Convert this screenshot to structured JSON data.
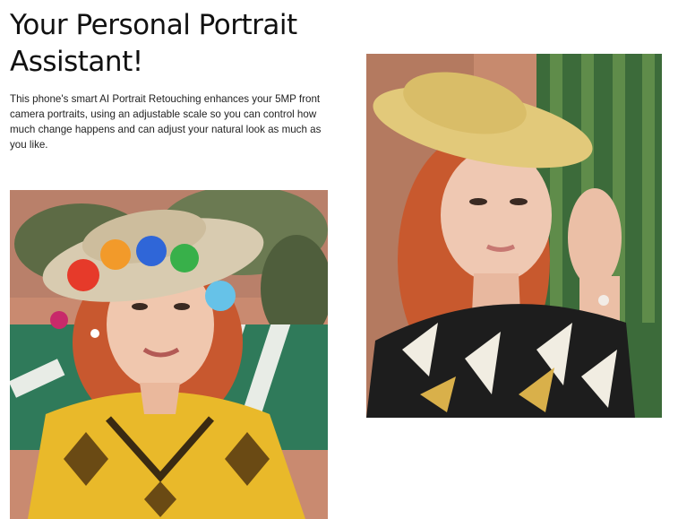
{
  "headline": {
    "line1": "Your Personal Portrait",
    "line2": "Assistant!"
  },
  "description": "This phone's smart AI Portrait Retouching enhances your 5MP front camera portraits, using an adjustable scale so you can control how much change happens and can adjust your natural look as much as you like.",
  "photos": [
    {
      "name": "portrait-photo-colorful-hat",
      "subject": "woman with red hair wearing a straw hat with rainbow pom-poms and a yellow patterned top, smiling selfie"
    },
    {
      "name": "portrait-photo-straw-hat",
      "subject": "woman with red hair wearing a straw sun hat and a black and white leaf-print top, in front of a cactus"
    }
  ],
  "colors": {
    "text": "#111111",
    "background": "#ffffff"
  }
}
